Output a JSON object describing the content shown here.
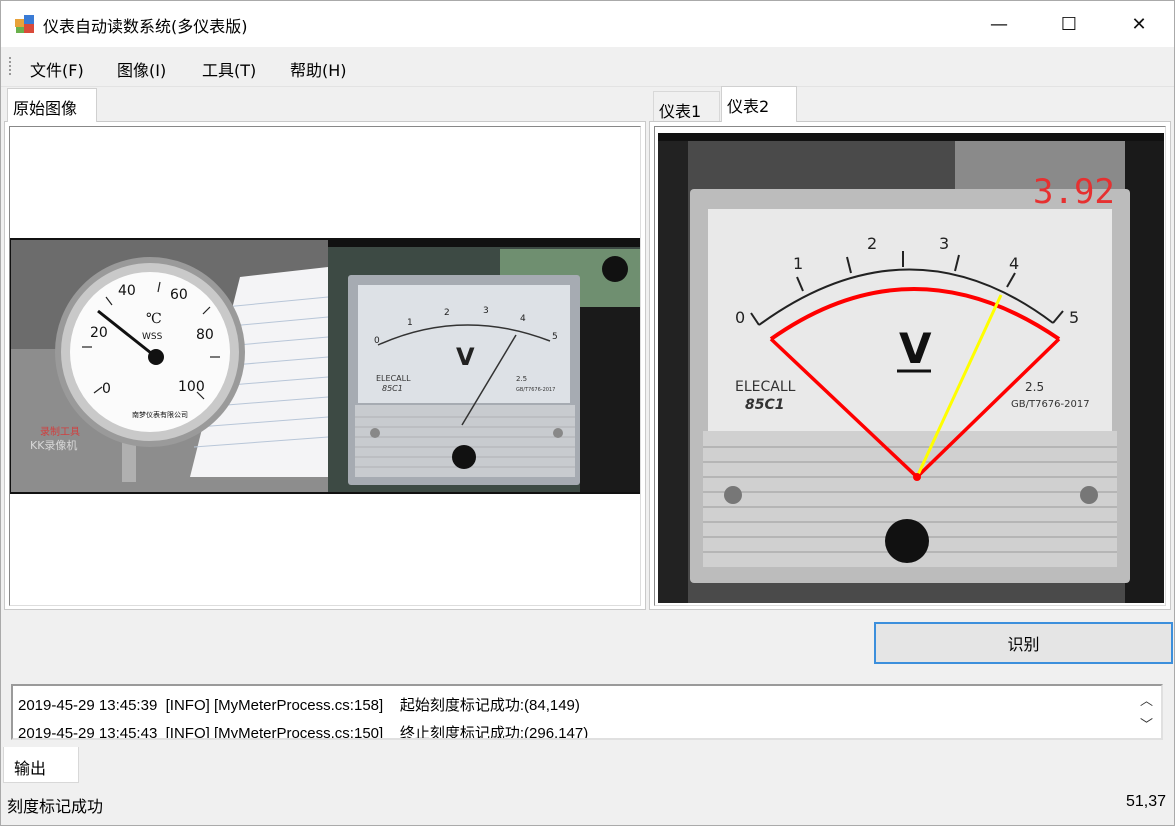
{
  "window": {
    "title": "仪表自动读数系统(多仪表版)",
    "minimize_glyph": "—",
    "maximize_glyph": "☐",
    "close_glyph": "✕"
  },
  "menu": {
    "items": [
      {
        "label": "文件(F)"
      },
      {
        "label": "图像(I)"
      },
      {
        "label": "工具(T)"
      },
      {
        "label": "帮助(H)"
      }
    ]
  },
  "left_panel": {
    "tab_label": "原始图像",
    "thermometer": {
      "unit": "℃",
      "brand": "WSS",
      "ticks": [
        "0",
        "20",
        "40",
        "60",
        "80",
        "100"
      ],
      "maker": "南梦仪表有限公司",
      "watermark_line1": "录制工具",
      "watermark_line2": "KK录像机"
    },
    "voltmeter": {
      "ticks": [
        "0",
        "1",
        "2",
        "3",
        "4",
        "5"
      ],
      "unit": "V",
      "brand": "ELECALL",
      "model": "85C1",
      "spec": "2.5",
      "standard": "GB/T7676-2017"
    }
  },
  "right_panel": {
    "tabs": [
      {
        "label": "仪表1"
      },
      {
        "label": "仪表2"
      }
    ],
    "active_tab": 1,
    "reading": "3.92",
    "meter": {
      "ticks": [
        "0",
        "1",
        "2",
        "3",
        "4",
        "5"
      ],
      "unit": "V",
      "brand": "ELECALL",
      "model": "85C1",
      "spec": "2.5",
      "standard": "GB/T7676-2017"
    },
    "colors": {
      "arc": "#ff0000",
      "needle_overlay": "#ffff00",
      "reading": "#e63030"
    }
  },
  "recognize_button": {
    "label": "识别"
  },
  "log": {
    "lines": [
      "2019-45-29 13:45:39  [INFO] [MyMeterProcess.cs:158]    起始刻度标记成功:(84,149)",
      "2019-45-29 13:45:43  [INFO] [MyMeterProcess.cs:150]    终止刻度标记成功:(296,147)"
    ],
    "scroll_up_glyph": "︿",
    "scroll_down_glyph": "﹀"
  },
  "output_tab": {
    "label": "输出"
  },
  "status": {
    "message": "刻度标记成功",
    "position": "51,37"
  }
}
